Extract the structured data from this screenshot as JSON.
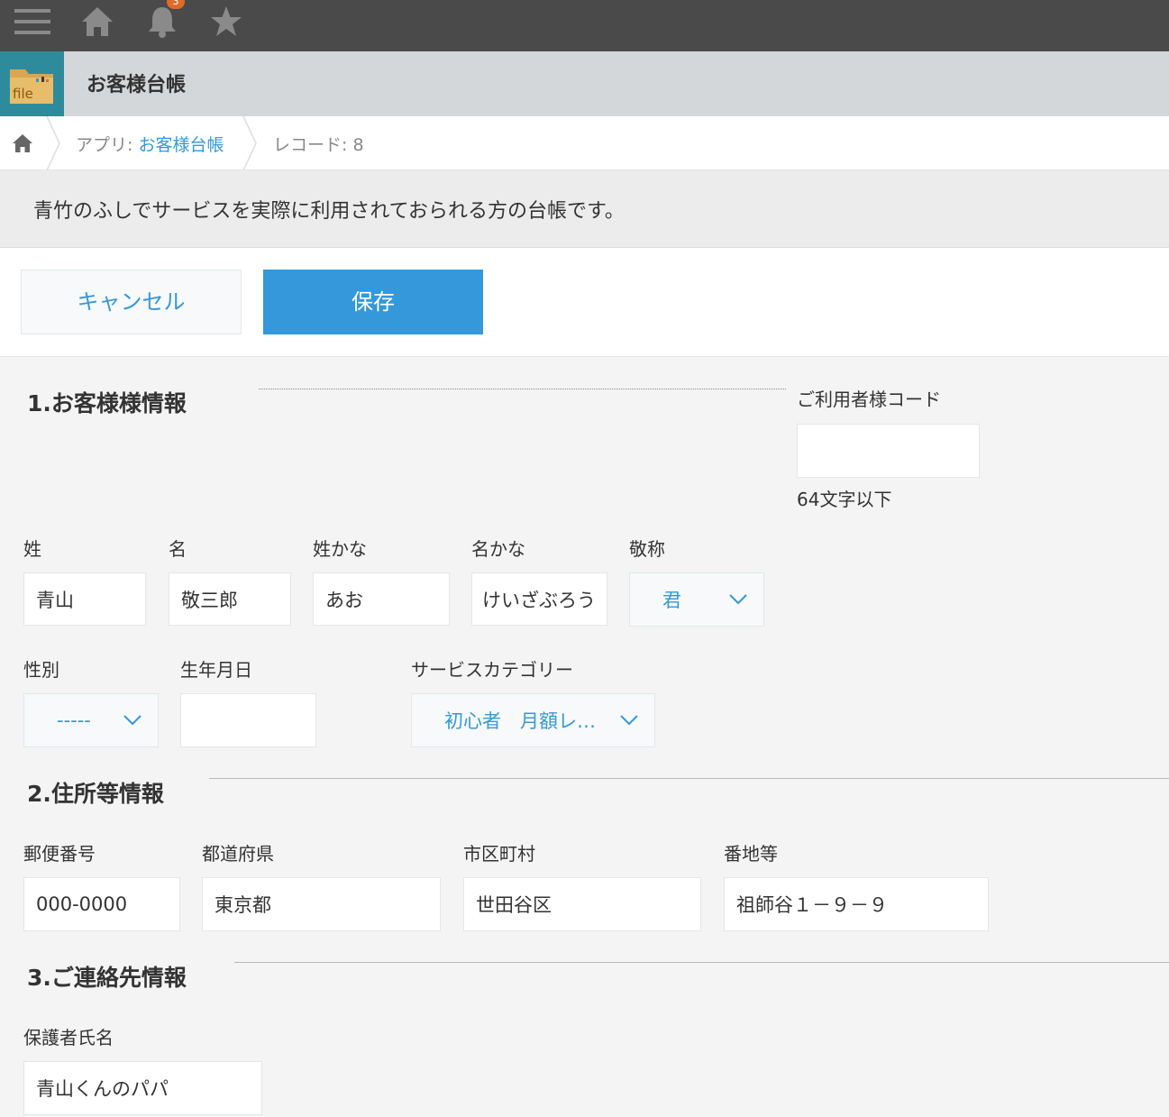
{
  "topbar": {
    "menu_icon": "hamburger-menu-icon",
    "home_icon": "home-icon",
    "bell_icon": "bell-icon",
    "notification_count": "3",
    "star_icon": "star-icon",
    "bg_color": "#4a4a4a"
  },
  "app": {
    "icon": "file-folder-icon",
    "icon_text": "file",
    "title": "お客様台帳"
  },
  "breadcrumb": {
    "home_icon": "home-icon",
    "app_prefix": "アプリ: ",
    "app_link": "お客様台帳",
    "record": "レコード: 8"
  },
  "description": "青竹のふしでサービスを実際に利用されておられる方の台帳です。",
  "toolbar": {
    "cancel_label": "キャンセル",
    "save_label": "保存",
    "accent_color": "#3498db"
  },
  "section1": {
    "title": "1.お客様様情報",
    "user_code": {
      "label": "ご利用者様コード",
      "value": "",
      "hint": "64文字以下"
    },
    "last_name": {
      "label": "姓",
      "value": "青山"
    },
    "first_name": {
      "label": "名",
      "value": "敬三郎"
    },
    "last_kana": {
      "label": "姓かな",
      "value": "あお"
    },
    "first_kana": {
      "label": "名かな",
      "value": "けいざぶろう"
    },
    "honorific": {
      "label": "敬称",
      "value": "君"
    },
    "gender": {
      "label": "性別",
      "value": "-----"
    },
    "birthday": {
      "label": "生年月日",
      "value": ""
    },
    "service_category": {
      "label": "サービスカテゴリー",
      "value": "初心者　月額レ…"
    }
  },
  "section2": {
    "title": "2.住所等情報",
    "postal": {
      "label": "郵便番号",
      "value": "000-0000"
    },
    "prefecture": {
      "label": "都道府県",
      "value": "東京都"
    },
    "city": {
      "label": "市区町村",
      "value": "世田谷区"
    },
    "address": {
      "label": "番地等",
      "value": "祖師谷１－９－９"
    }
  },
  "section3": {
    "title": "3.ご連絡先情報",
    "guardian": {
      "label": "保護者氏名",
      "value": "青山くんのパパ"
    }
  }
}
